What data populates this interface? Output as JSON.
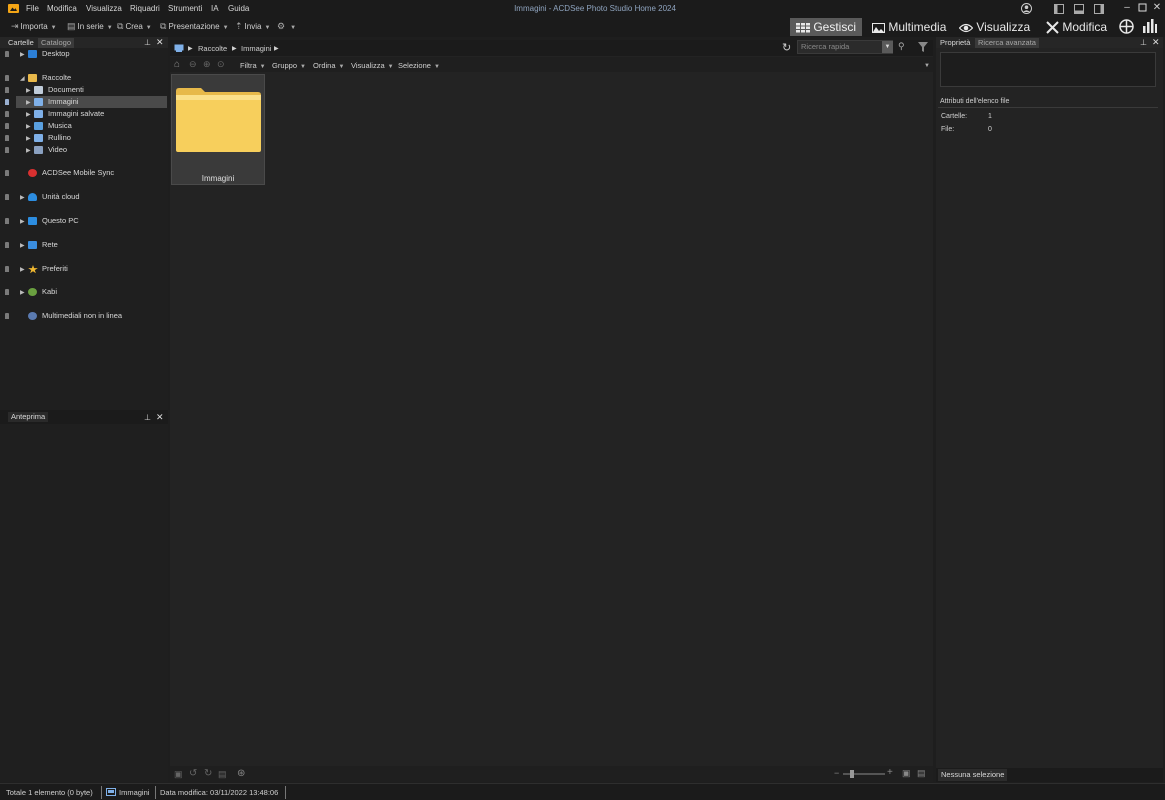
{
  "window": {
    "title": "Immagini - ACDSee Photo Studio Home 2024"
  },
  "menu": [
    "File",
    "Modifica",
    "Visualizza",
    "Riquadri",
    "Strumenti",
    "IA",
    "Guida"
  ],
  "toolbar": {
    "importa": "Importa",
    "in_serie": "In serie",
    "crea": "Crea",
    "presentazione": "Presentazione",
    "invia": "Invia"
  },
  "modes": {
    "gestisci": "Gestisci",
    "multimedia": "Multimedia",
    "visualizza": "Visualizza",
    "modifica": "Modifica"
  },
  "left_panel": {
    "tabs": [
      "Cartelle",
      "Catalogo"
    ],
    "tree": [
      {
        "label": "Desktop",
        "icon": "desktop-icon",
        "color": "#2c7fd6"
      },
      {
        "label": "Raccolte",
        "icon": "collections-icon",
        "color": "#e8b84a"
      },
      {
        "label": "Documenti",
        "icon": "documents-icon",
        "color": "#bfcbd9"
      },
      {
        "label": "Immagini",
        "icon": "pictures-icon",
        "color": "#7fb0e8"
      },
      {
        "label": "Immagini salvate",
        "icon": "saved-pictures-icon",
        "color": "#7fb0e8"
      },
      {
        "label": "Musica",
        "icon": "music-icon",
        "color": "#5aa0e0"
      },
      {
        "label": "Rullino",
        "icon": "camera-roll-icon",
        "color": "#7fb0e8"
      },
      {
        "label": "Video",
        "icon": "video-icon",
        "color": "#8aa0c0"
      },
      {
        "label": "ACDSee Mobile Sync",
        "icon": "mobile-sync-icon",
        "color": "#d83030"
      },
      {
        "label": "Unità cloud",
        "icon": "cloud-icon",
        "color": "#2c8de0"
      },
      {
        "label": "Questo PC",
        "icon": "pc-icon",
        "color": "#2c8de0"
      },
      {
        "label": "Rete",
        "icon": "network-icon",
        "color": "#3a8ee0"
      },
      {
        "label": "Preferiti",
        "icon": "star-icon",
        "color": "#f0b830"
      },
      {
        "label": "Kabi",
        "icon": "user-icon",
        "color": "#6aa040"
      },
      {
        "label": "Multimediali non in linea",
        "icon": "offline-media-icon",
        "color": "#5a7ab0"
      }
    ],
    "preview_tab": "Anteprima"
  },
  "address": {
    "crumbs": [
      "Raccolte",
      "Immagini"
    ],
    "search_placeholder": "Ricerca rapida"
  },
  "filterbar": [
    "Filtra",
    "Gruppo",
    "Ordina",
    "Visualizza",
    "Selezione"
  ],
  "content": {
    "items": [
      {
        "label": "Immagini",
        "type": "folder"
      }
    ]
  },
  "right_panel": {
    "tabs": [
      "Proprietà",
      "Ricerca avanzata"
    ],
    "section_title": "Attributi dell'elenco file",
    "attributes": [
      {
        "label": "Cartelle:",
        "value": "1"
      },
      {
        "label": "File:",
        "value": "0"
      }
    ],
    "bottom_tab": "Nessuna selezione"
  },
  "status": {
    "total": "Totale 1 elemento  (0 byte)",
    "location": "Immagini",
    "modified": "Data modifica: 03/11/2022 13:48:06"
  }
}
